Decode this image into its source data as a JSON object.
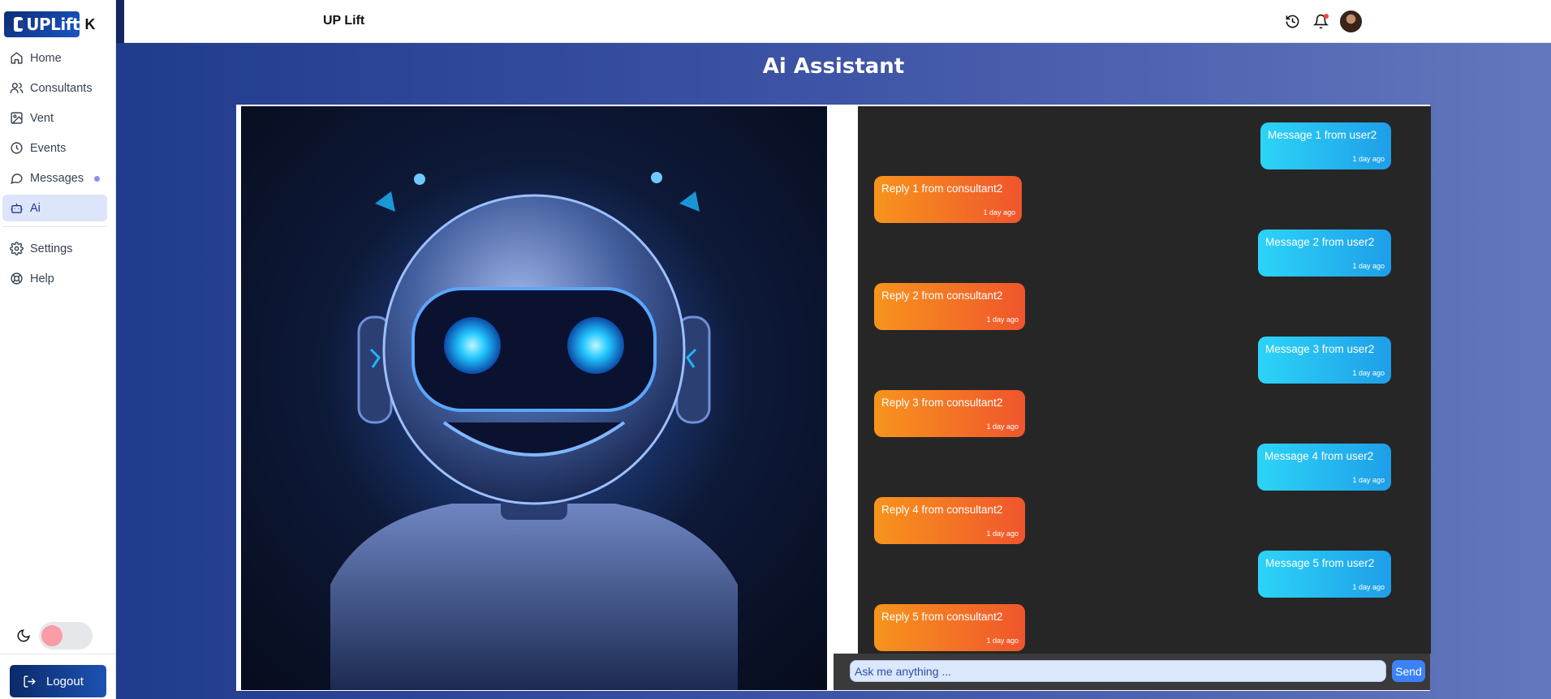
{
  "brand": {
    "name": "UPLift",
    "collapse_icon": "collapse-icon"
  },
  "sidebar": {
    "items": [
      {
        "label": "Home",
        "icon": "home-icon"
      },
      {
        "label": "Consultants",
        "icon": "users-icon"
      },
      {
        "label": "Vent",
        "icon": "image-icon"
      },
      {
        "label": "Events",
        "icon": "clock-icon"
      },
      {
        "label": "Messages",
        "icon": "message-icon",
        "unread": true
      },
      {
        "label": "Ai",
        "icon": "bot-icon",
        "active": true
      },
      {
        "label": "Settings",
        "icon": "gear-icon"
      },
      {
        "label": "Help",
        "icon": "lifebuoy-icon"
      }
    ],
    "theme_toggle": {
      "icon": "moon-icon",
      "enabled": false
    },
    "logout_label": "Logout"
  },
  "header": {
    "title": "UP Lift",
    "icons": [
      "history-icon",
      "bell-icon",
      "avatar"
    ]
  },
  "main": {
    "title": "Ai Assistant",
    "chat": {
      "messages": [
        {
          "from": "user",
          "text": "Message 1 from user2",
          "time": "1 day ago"
        },
        {
          "from": "ai",
          "text": "Reply 1 from consultant2",
          "time": "1 day ago"
        },
        {
          "from": "user",
          "text": "Message 2 from user2",
          "time": "1 day ago"
        },
        {
          "from": "ai",
          "text": "Reply 2 from consultant2",
          "time": "1 day ago"
        },
        {
          "from": "user",
          "text": "Message 3 from user2",
          "time": "1 day ago"
        },
        {
          "from": "ai",
          "text": "Reply 3 from consultant2",
          "time": "1 day ago"
        },
        {
          "from": "user",
          "text": "Message 4 from user2",
          "time": "1 day ago"
        },
        {
          "from": "ai",
          "text": "Reply 4 from consultant2",
          "time": "1 day ago"
        },
        {
          "from": "user",
          "text": "Message 5 from user2",
          "time": "1 day ago"
        },
        {
          "from": "ai",
          "text": "Reply 5 from consultant2",
          "time": "1 day ago"
        }
      ],
      "input_placeholder": "Ask me anything ...",
      "send_label": "Send"
    }
  },
  "colors": {
    "brand": "#0d2c75",
    "user_bubble": "#2dd4f7",
    "ai_bubble": "#f7941d",
    "chat_bg": "#262626",
    "active_nav_bg": "#dde5fb"
  }
}
